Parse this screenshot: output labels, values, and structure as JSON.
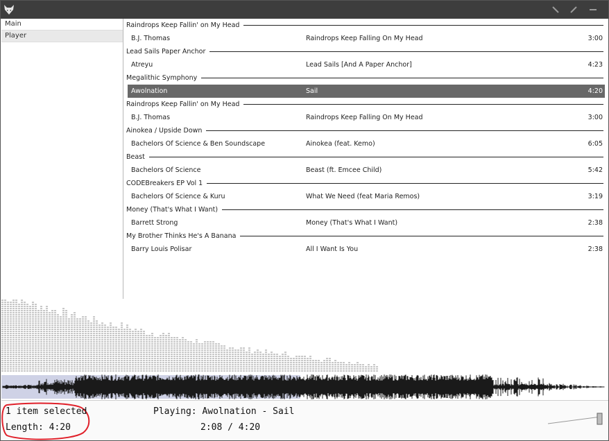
{
  "window": {
    "accent": "#3d3d3d",
    "buttons": [
      {
        "name": "resize-button",
        "icon": "diagonal-arrow-icon"
      },
      {
        "name": "edit-button",
        "icon": "pencil-icon"
      },
      {
        "name": "minimize-button",
        "icon": "minimize-icon"
      }
    ]
  },
  "sidebar": {
    "items": [
      {
        "label": "Main",
        "active": false
      },
      {
        "label": "Player",
        "active": true
      }
    ]
  },
  "playlist": [
    {
      "album": "Raindrops Keep Fallin' on My Head",
      "artist": "B.J. Thomas",
      "title": "Raindrops Keep Falling On My Head",
      "length": "3:00",
      "selected": false
    },
    {
      "album": "Lead Sails Paper Anchor",
      "artist": "Atreyu",
      "title": "Lead Sails [And A Paper Anchor]",
      "length": "4:23",
      "selected": false
    },
    {
      "album": "Megalithic Symphony",
      "artist": "Awolnation",
      "title": "Sail",
      "length": "4:20",
      "selected": true
    },
    {
      "album": "Raindrops Keep Fallin' on My Head",
      "artist": "B.J. Thomas",
      "title": "Raindrops Keep Falling On My Head",
      "length": "3:00",
      "selected": false
    },
    {
      "album": "Ainokea / Upside Down",
      "artist": "Bachelors Of Science & Ben Soundscape",
      "title": "Ainokea (feat. Kemo)",
      "length": "6:05",
      "selected": false
    },
    {
      "album": "Beast",
      "artist": "Bachelors Of Science",
      "title": "Beast (ft. Emcee Child)",
      "length": "5:42",
      "selected": false
    },
    {
      "album": "CODEBreakers EP Vol 1",
      "artist": "Bachelors Of Science & Kuru",
      "title": "What We Need (feat Maria Remos)",
      "length": "3:19",
      "selected": false
    },
    {
      "album": "Money (That's What I Want)",
      "artist": "Barrett Strong",
      "title": "Money (That's What I Want)",
      "length": "2:38",
      "selected": false
    },
    {
      "album": "My Brother Thinks He's A Banana",
      "artist": "Barry Louis Polisar",
      "title": "All I Want Is You",
      "length": "2:38",
      "selected": false
    }
  ],
  "visualizer": {
    "spectrum_color": "#c8c8c8",
    "waveform_color": "#1a1a1a",
    "played_region_color": "#cfd2e6",
    "progress": 0.492
  },
  "status": {
    "selection": "1 item selected",
    "length": "Length: 4:20",
    "now_playing": "Playing:  Awolnation - Sail",
    "time": "2:08 / 4:20",
    "volume": 1.0
  }
}
